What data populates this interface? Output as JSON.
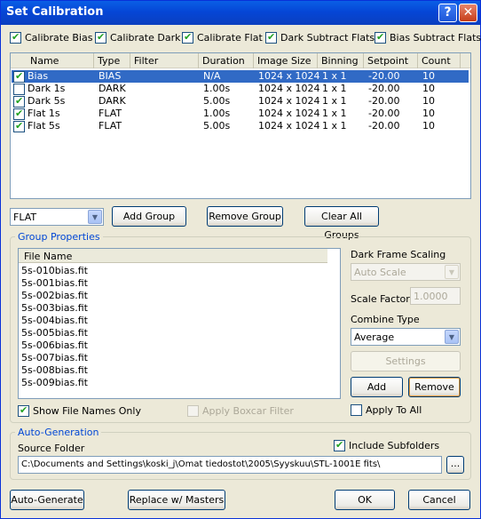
{
  "window": {
    "title": "Set Calibration",
    "help_label": "?",
    "close_label": "✕"
  },
  "options": [
    {
      "label": "Calibrate Bias",
      "checked": true
    },
    {
      "label": "Calibrate Dark",
      "checked": true
    },
    {
      "label": "Calibrate Flat",
      "checked": true
    },
    {
      "label": "Dark Subtract Flats",
      "checked": true
    },
    {
      "label": "Bias Subtract Flats",
      "checked": true
    }
  ],
  "groups_table": {
    "columns": [
      "Name",
      "Type",
      "Filter",
      "Duration",
      "Image Size",
      "Binning",
      "Setpoint",
      "Count"
    ],
    "rows": [
      {
        "checked": true,
        "selected": true,
        "cells": [
          "Bias",
          "BIAS",
          "",
          "N/A",
          "1024 x 1024",
          "1 x 1",
          "-20.00",
          "10"
        ]
      },
      {
        "checked": false,
        "selected": false,
        "cells": [
          "Dark 1s",
          "DARK",
          "",
          "1.00s",
          "1024 x 1024",
          "1 x 1",
          "-20.00",
          "10"
        ]
      },
      {
        "checked": true,
        "selected": false,
        "cells": [
          "Dark 5s",
          "DARK",
          "",
          "5.00s",
          "1024 x 1024",
          "1 x 1",
          "-20.00",
          "10"
        ]
      },
      {
        "checked": true,
        "selected": false,
        "cells": [
          "Flat 1s",
          "FLAT",
          "",
          "1.00s",
          "1024 x 1024",
          "1 x 1",
          "-20.00",
          "10"
        ]
      },
      {
        "checked": true,
        "selected": false,
        "cells": [
          "Flat 5s",
          "FLAT",
          "",
          "5.00s",
          "1024 x 1024",
          "1 x 1",
          "-20.00",
          "10"
        ]
      }
    ]
  },
  "group_toolbar": {
    "type_select": "FLAT",
    "add_group": "Add Group",
    "remove_group": "Remove Group",
    "clear_all_groups": "Clear All Groups"
  },
  "group_properties": {
    "title": "Group Properties",
    "file_column": "File Name",
    "files": [
      "5s-010bias.fit",
      "5s-001bias.fit",
      "5s-002bias.fit",
      "5s-003bias.fit",
      "5s-004bias.fit",
      "5s-005bias.fit",
      "5s-006bias.fit",
      "5s-007bias.fit",
      "5s-008bias.fit",
      "5s-009bias.fit"
    ],
    "show_file_names_only": "Show File Names Only",
    "apply_boxcar_filter": "Apply Boxcar Filter",
    "dark_frame_scaling_label": "Dark Frame Scaling",
    "dark_frame_scaling_value": "Auto Scale",
    "scale_factor_label": "Scale Factor",
    "scale_factor_value": "1.0000",
    "combine_type_label": "Combine Type",
    "combine_type_value": "Average",
    "settings_button": "Settings",
    "add_button": "Add",
    "remove_button": "Remove",
    "apply_to_all": "Apply To All"
  },
  "auto_generation": {
    "title": "Auto-Generation",
    "source_folder_label": "Source Folder",
    "include_subfolders": "Include Subfolders",
    "path": "C:\\Documents and Settings\\koski_j\\Omat tiedostot\\2005\\Syyskuu\\STL-1001E fits\\",
    "browse_label": "..."
  },
  "footer": {
    "auto_generate": "Auto-Generate",
    "replace_with_masters": "Replace w/ Masters",
    "ok": "OK",
    "cancel": "Cancel"
  },
  "colors": {
    "title_bar": "#0a5fe6",
    "selection": "#316ac5",
    "group_label": "#0046d5"
  }
}
